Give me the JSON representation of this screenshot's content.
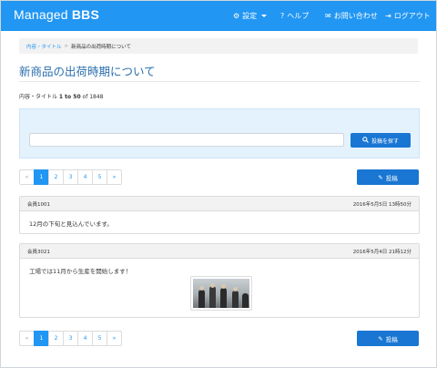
{
  "navbar": {
    "brand_prefix": "Managed ",
    "brand_bold": "BBS",
    "settings_label": "設定",
    "help_label": "ヘルプ",
    "contact_label": "お問い合わせ",
    "logout_label": "ログアウト",
    "settings_icon": "gear-icon",
    "help_icon": "question-circle-icon",
    "contact_icon": "envelope-icon",
    "logout_icon": "sign-out-icon"
  },
  "breadcrumb": {
    "item1": "内容・タイトル",
    "separator": ">",
    "current": "新商品の出荷時期について"
  },
  "page_title": "新商品の出荷時期について",
  "result_count": {
    "prefix": "内容・タイトル ",
    "range": "1 to 50",
    "of": " of ",
    "total": "1848"
  },
  "search": {
    "placeholder": "",
    "button_label": "投稿を探す",
    "button_icon": "search-icon"
  },
  "pagination": {
    "prev": "«",
    "pages": [
      "1",
      "2",
      "3",
      "4",
      "5"
    ],
    "next": "»",
    "active_page": "1"
  },
  "post_button": {
    "label": "投稿",
    "icon": "pencil-icon"
  },
  "posts": [
    {
      "author": "会員1001",
      "date": "2016年5月5日 13時50分",
      "body": "12月の下旬と見込んでいます。"
    },
    {
      "author": "会員3021",
      "date": "2016年5月4日 21時12分",
      "body": "工場では11月から生産を開始します！",
      "image": "factory-workers-photo"
    }
  ],
  "colors": {
    "primary": "#2196f3",
    "button": "#1976d2",
    "title": "#2a6fad",
    "search_bg": "#e3f2fd"
  }
}
